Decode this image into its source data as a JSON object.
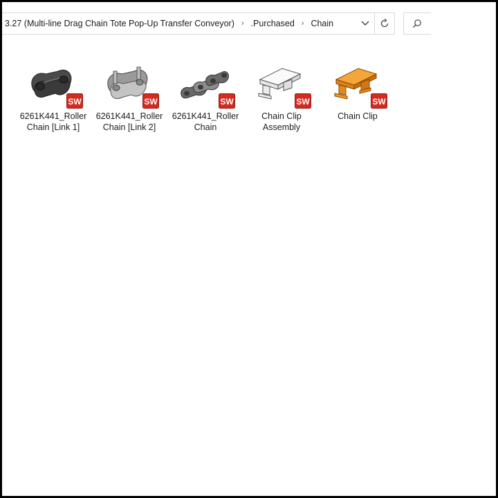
{
  "address": {
    "crumbs": [
      "3.27 (Multi-line Drag Chain Tote Pop-Up Transfer Conveyor)",
      ".Purchased",
      "Chain"
    ]
  },
  "toolbar": {
    "dropdown_icon": "chevron-down-icon",
    "refresh_icon": "refresh-icon",
    "search_icon": "search-icon"
  },
  "files": [
    {
      "name_line1": "6261K441_Roller",
      "name_line2": "Chain [Link 1]",
      "badge": "SW"
    },
    {
      "name_line1": "6261K441_Roller",
      "name_line2": "Chain [Link 2]",
      "badge": "SW"
    },
    {
      "name_line1": "6261K441_Roller",
      "name_line2": "Chain",
      "badge": "SW"
    },
    {
      "name_line1": "Chain Clip",
      "name_line2": "Assembly",
      "badge": "SW"
    },
    {
      "name_line1": "Chain Clip",
      "name_line2": "",
      "badge": "SW"
    }
  ],
  "colors": {
    "sw_badge": "#d42a1f",
    "clip_orange": "#f2961f"
  }
}
